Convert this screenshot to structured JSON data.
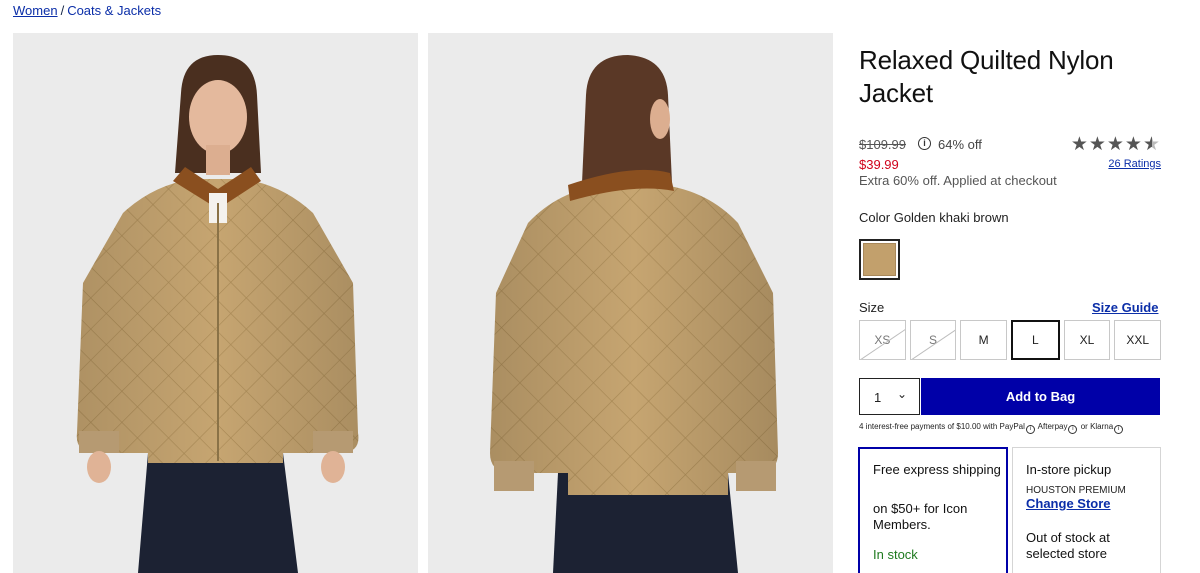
{
  "breadcrumb": {
    "parent": "Women",
    "separator": "/",
    "current": "Coats & Jackets"
  },
  "images": {
    "front_alt": "Front view of model wearing jacket",
    "back_alt": "Back view of model wearing jacket",
    "jacket_color": "#c2a06c",
    "collar_color": "#8a4f1f"
  },
  "product": {
    "title": "Relaxed Quilted Nylon Jacket",
    "original_price": "$109.99",
    "info_icon_glyph": "i",
    "discount": "64% off",
    "sale_price": "$39.99",
    "extra_note": "Extra 60% off. Applied at checkout",
    "rating": 4.5,
    "stars_text": "★★★★★",
    "ratings_link": "26 Ratings"
  },
  "color": {
    "label": "Color",
    "name": "Golden khaki brown",
    "swatch_hex": "#c2a06c"
  },
  "size": {
    "label": "Size",
    "guide_link": "Size Guide",
    "options": [
      {
        "label": "XS",
        "available": false,
        "selected": false
      },
      {
        "label": "S",
        "available": false,
        "selected": false
      },
      {
        "label": "M",
        "available": true,
        "selected": false
      },
      {
        "label": "L",
        "available": true,
        "selected": true
      },
      {
        "label": "XL",
        "available": true,
        "selected": false
      },
      {
        "label": "XXL",
        "available": true,
        "selected": false
      }
    ]
  },
  "purchase": {
    "quantity": "1",
    "add_to_bag": "Add to Bag",
    "pay_note_prefix": "4 interest-free payments of $10.00 with",
    "paypal": "PayPal",
    "afterpay": "Afterpay",
    "or": "or",
    "klarna": "Klarna",
    "accent": "#0000a8"
  },
  "shipping": {
    "express_title": "Free express shipping",
    "express_detail": "on $50+ for Icon Members.",
    "express_status": "In stock",
    "pickup_title": "In-store pickup",
    "pickup_store": "HOUSTON PREMIUM",
    "change_store": "Change Store",
    "pickup_status": "Out of stock at selected store"
  }
}
